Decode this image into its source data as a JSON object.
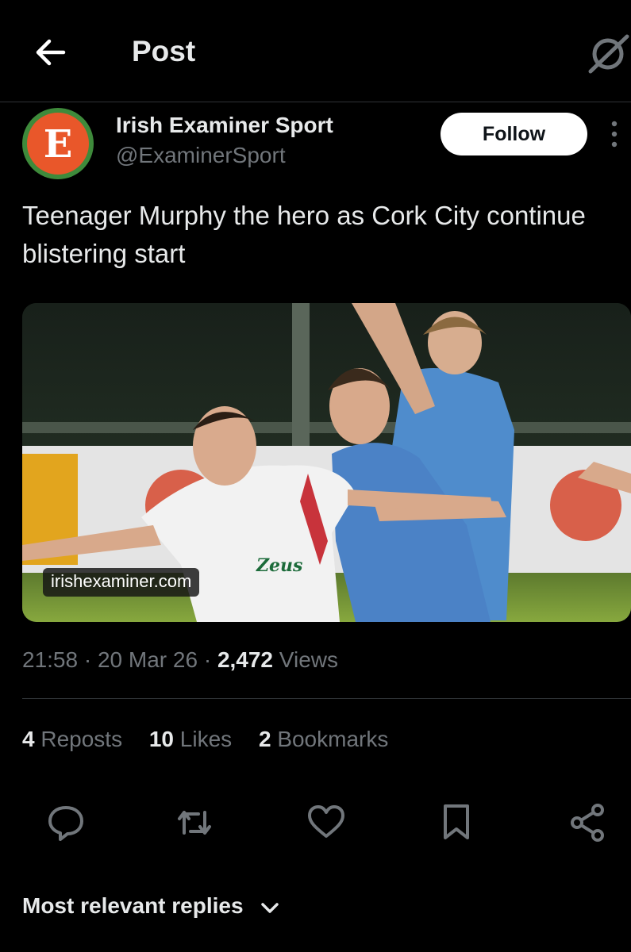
{
  "header": {
    "title": "Post",
    "back_icon": "arrow-left-icon",
    "grok_icon": "grok-icon"
  },
  "author": {
    "name": "Irish Examiner Sport",
    "handle": "@ExaminerSport",
    "follow_label": "Follow",
    "avatar_letter": "E"
  },
  "tweet": {
    "text": "Teenager Murphy the hero as Cork City continue blistering start",
    "media": {
      "domain": "irishexaminer.com",
      "shirt_sponsor": "Zeus"
    }
  },
  "meta": {
    "time": "21:58",
    "sep": "·",
    "date": "20 Mar 26",
    "views_count": "2,472",
    "views_label": "Views"
  },
  "stats": {
    "reposts_count": "4",
    "reposts_label": "Reposts",
    "likes_count": "10",
    "likes_label": "Likes",
    "bookmarks_count": "2",
    "bookmarks_label": "Bookmarks"
  },
  "actions": [
    "reply-icon",
    "repost-icon",
    "like-icon",
    "bookmark-icon",
    "share-icon"
  ],
  "replies": {
    "label": "Most relevant replies"
  },
  "colors": {
    "background": "#000000",
    "text": "#e7e9ea",
    "muted": "#71767b",
    "divider": "#2f3336"
  }
}
